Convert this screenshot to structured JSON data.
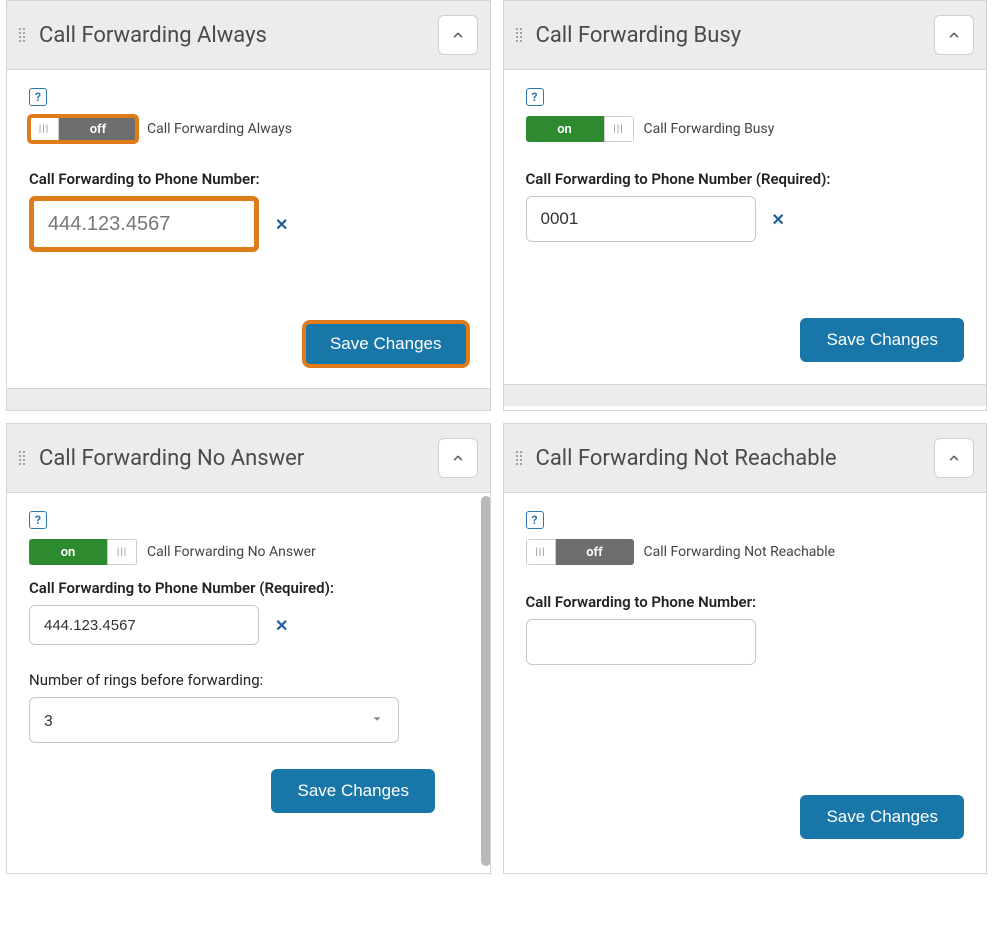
{
  "panels": {
    "always": {
      "title": "Call Forwarding Always",
      "toggle_state": "off",
      "toggle_text": "off",
      "feature_label": "Call Forwarding Always",
      "phone_label": "Call Forwarding to Phone Number:",
      "phone_value": "444.123.4567",
      "save_label": "Save Changes"
    },
    "busy": {
      "title": "Call Forwarding Busy",
      "toggle_state": "on",
      "toggle_text": "on",
      "feature_label": "Call Forwarding Busy",
      "phone_label": "Call Forwarding to Phone Number (Required):",
      "phone_value": "0001",
      "save_label": "Save Changes"
    },
    "noanswer": {
      "title": "Call Forwarding No Answer",
      "toggle_state": "on",
      "toggle_text": "on",
      "feature_label": "Call Forwarding No Answer",
      "phone_label": "Call Forwarding to Phone Number (Required):",
      "phone_value": "444.123.4567",
      "rings_label": "Number of rings before forwarding:",
      "rings_value": "3",
      "save_label": "Save Changes"
    },
    "notreach": {
      "title": "Call Forwarding Not Reachable",
      "toggle_state": "off",
      "toggle_text": "off",
      "feature_label": "Call Forwarding Not Reachable",
      "phone_label": "Call Forwarding to Phone Number:",
      "phone_value": "",
      "save_label": "Save Changes"
    }
  },
  "help_glyph": "?",
  "clear_glyph": "✕",
  "knob_glyph": "|||"
}
